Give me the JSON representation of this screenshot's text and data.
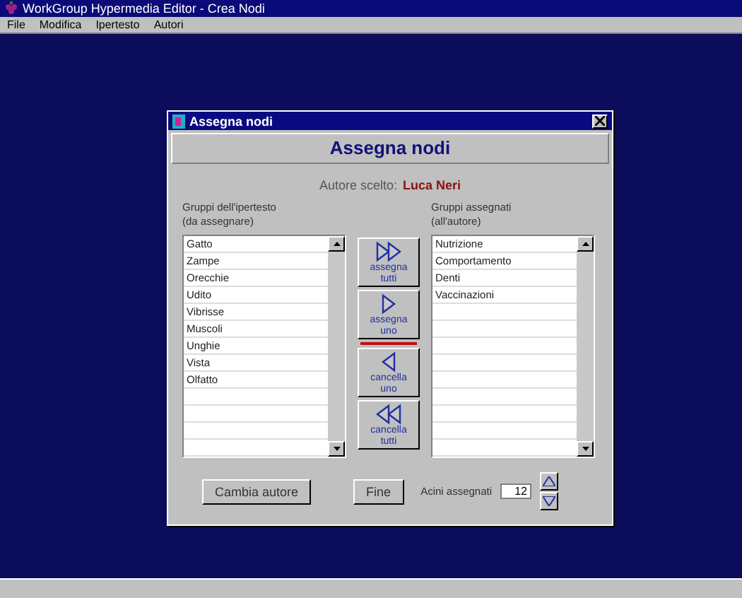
{
  "window": {
    "title": "WorkGroup Hypermedia Editor - Crea Nodi"
  },
  "menu": [
    "File",
    "Modifica",
    "Ipertesto",
    "Autori"
  ],
  "dialog": {
    "title": "Assegna nodi",
    "heading": "Assegna nodi",
    "author_label": "Autore scelto:",
    "author_name": "Luca Neri",
    "left_list": {
      "label": "Gruppi dell'ipertesto\n(da assegnare)",
      "items": [
        "Gatto",
        "Zampe",
        "Orecchie",
        "Udito",
        "Vibrisse",
        "Muscoli",
        "Unghie",
        "Vista",
        "Olfatto"
      ]
    },
    "right_list": {
      "label": "Gruppi assegnati\n(all'autore)",
      "items": [
        "Nutrizione",
        "Comportamento",
        "Denti",
        "Vaccinazioni"
      ]
    },
    "actions": [
      {
        "kind": "all-right",
        "label": "assegna\ntutti"
      },
      {
        "kind": "one-right",
        "label": "assegna\nuno"
      },
      {
        "kind": "one-left",
        "label": "cancella\nuno"
      },
      {
        "kind": "all-left",
        "label": "cancella\ntutti"
      }
    ],
    "change_author_button": "Cambia autore",
    "finish_button": "Fine",
    "count_label": "Acini assegnati",
    "count_value": "12"
  }
}
